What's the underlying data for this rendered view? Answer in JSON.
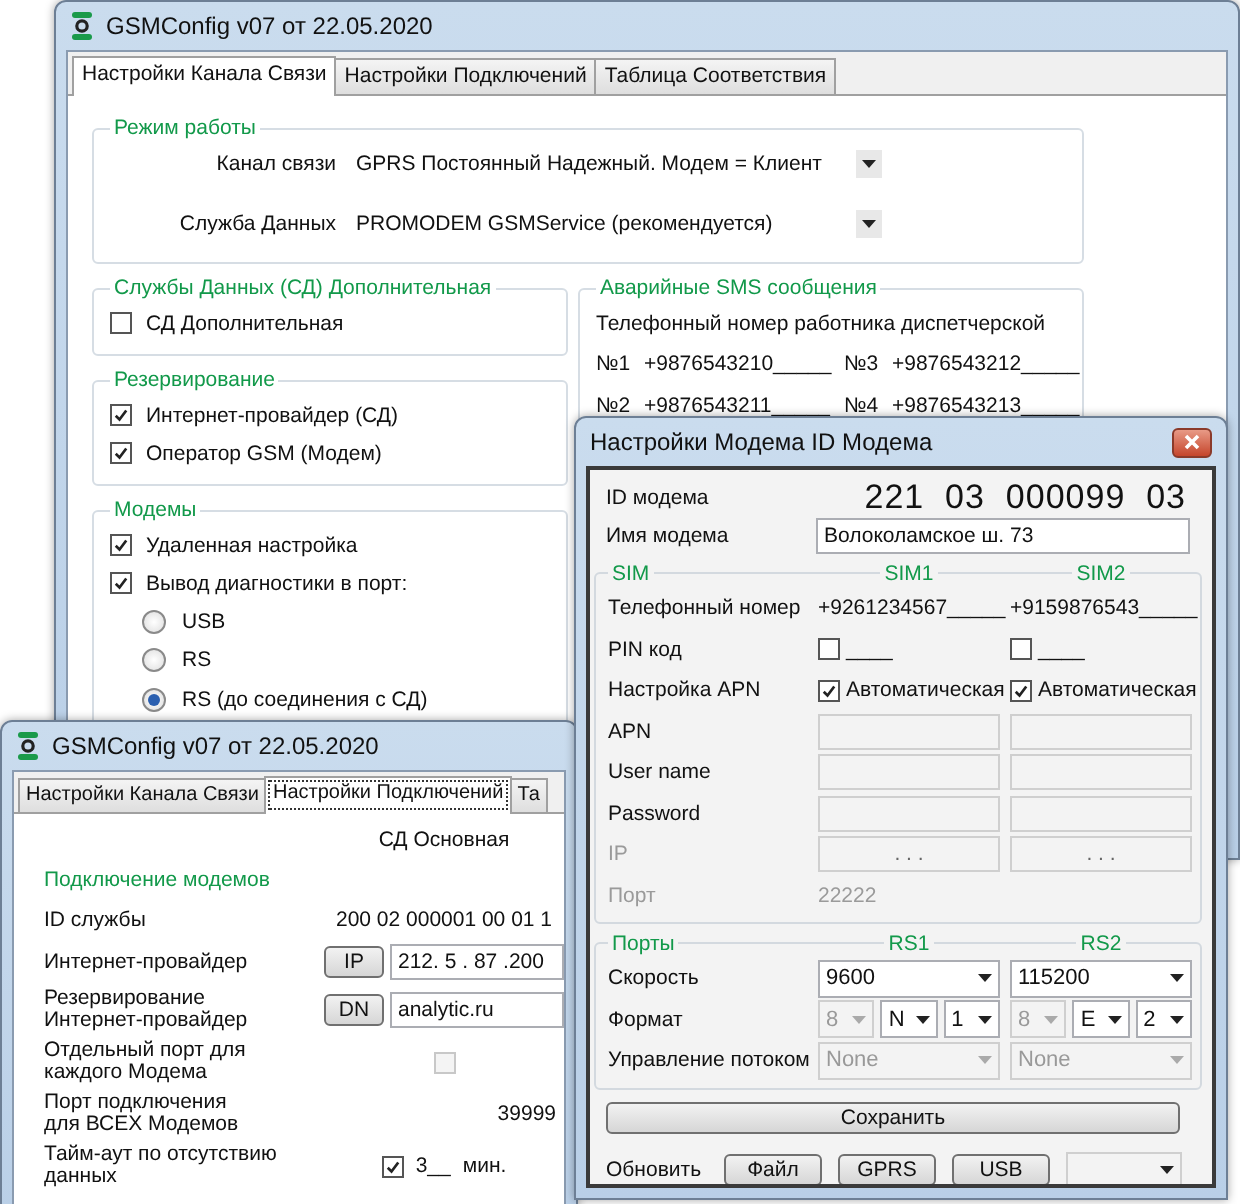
{
  "main_window": {
    "title": "GSMConfig v07 от 22.05.2020",
    "tabs": [
      {
        "label": "Настройки Канала Связи",
        "selected": true
      },
      {
        "label": "Настройки Подключений",
        "selected": false
      },
      {
        "label": "Таблица Соответствия",
        "selected": false
      }
    ],
    "mode_group": {
      "title": "Режим работы",
      "rows": [
        {
          "label": "Канал связи",
          "value": "GPRS Постоянный Надежный. Модем = Клиент"
        },
        {
          "label": "Служба Данных",
          "value": "PROMODEM GSMService (рекомендуется)"
        }
      ]
    },
    "extra_group": {
      "title": "Службы Данных (СД) Дополнительная",
      "items": [
        {
          "label": "СД Дополнительная",
          "checked": false
        }
      ]
    },
    "reserve_group": {
      "title": "Резервирование",
      "items": [
        {
          "label": "Интернет-провайдер (СД)",
          "checked": true
        },
        {
          "label": "Оператор GSM (Модем)",
          "checked": true
        }
      ]
    },
    "modems_group": {
      "title": "Модемы",
      "items": [
        {
          "label": "Удаленная настройка",
          "checked": true
        },
        {
          "label": "Вывод диагностики в порт:",
          "checked": true
        }
      ],
      "port_options": [
        {
          "label": "USB",
          "selected": false
        },
        {
          "label": "RS",
          "selected": false
        },
        {
          "label": "RS (до соединения с СД)",
          "selected": true
        }
      ]
    },
    "sms_group": {
      "title": "Аварийные SMS сообщения",
      "caption": "Телефонный номер работника диспетчерской",
      "numbers": [
        {
          "label": "№1",
          "value": "+9876543210_____"
        },
        {
          "label": "№3",
          "value": "+9876543212_____"
        },
        {
          "label": "№2",
          "value": "+9876543211_____"
        },
        {
          "label": "№4",
          "value": "+9876543213_____"
        }
      ]
    }
  },
  "connections_window": {
    "title": "GSMConfig v07 от 22.05.2020",
    "tabs": [
      {
        "label": "Настройки Канала Связи",
        "selected": false
      },
      {
        "label": "Настройки Подключений",
        "selected": true
      },
      {
        "label": "Та",
        "selected": false
      }
    ],
    "column_header": "СД Основная",
    "section_title": "Подключение модемов",
    "rows": [
      {
        "kind": "text",
        "label": "ID службы",
        "value": "200 02 000001 00 01 1"
      },
      {
        "kind": "button_field",
        "label": "Интернет-провайдер",
        "button": "IP",
        "value": "212. 5 . 87 .200"
      },
      {
        "kind": "button_field",
        "label": "Резервирование\nИнтернет-провайдер",
        "button": "DN",
        "value": "analytic.ru"
      },
      {
        "kind": "check",
        "label": "Отдельный порт для\nкаждого Модема",
        "checked": false,
        "disabled": true
      },
      {
        "kind": "value",
        "label": "Порт подключения\nдля ВСЕХ Модемов",
        "value": "39999"
      },
      {
        "kind": "timeout",
        "label": "Тайм-аут по отсутствию\nданных",
        "checked": true,
        "value": "3__",
        "unit": "мин."
      }
    ]
  },
  "modem_dialog": {
    "title": "Настройки Модема ID Модема",
    "id_label": "ID модема",
    "id_value": "221  03  000099  03",
    "name_label": "Имя модема",
    "name_value": "Волоколамское ш. 73",
    "sim_group": {
      "title": "SIM",
      "columns": [
        "SIM1",
        "SIM2"
      ],
      "rows": [
        {
          "kind": "text",
          "label": "Телефонный номер",
          "disabled": false,
          "cells": [
            "+9261234567_____",
            "+9159876543_____"
          ]
        },
        {
          "kind": "check",
          "label": "PIN код",
          "disabled": false,
          "cells": [
            {
              "checked": false,
              "text": "____"
            },
            {
              "checked": false,
              "text": "____"
            }
          ]
        },
        {
          "kind": "check",
          "label": "Настройка APN",
          "disabled": false,
          "cells": [
            {
              "checked": true,
              "text": "Автоматическая"
            },
            {
              "checked": true,
              "text": "Автоматическая"
            }
          ]
        },
        {
          "kind": "field",
          "label": "APN",
          "disabled": false,
          "cells": [
            "",
            ""
          ]
        },
        {
          "kind": "field",
          "label": "User name",
          "disabled": false,
          "cells": [
            "",
            ""
          ]
        },
        {
          "kind": "field",
          "label": "Password",
          "disabled": false,
          "cells": [
            "",
            ""
          ]
        },
        {
          "kind": "field",
          "label": "IP",
          "disabled": true,
          "cells": [
            ".     .     .",
            ".     .     ."
          ]
        },
        {
          "kind": "text",
          "label": "Порт",
          "disabled": true,
          "cells": [
            "22222"
          ]
        }
      ]
    },
    "ports_group": {
      "title": "Порты",
      "columns": [
        "RS1",
        "RS2"
      ],
      "rows": [
        {
          "kind": "combo",
          "label": "Скорость",
          "cells": [
            [
              {
                "value": "9600",
                "disabled": false
              }
            ],
            [
              {
                "value": "115200",
                "disabled": false
              }
            ]
          ]
        },
        {
          "kind": "format",
          "label": "Формат",
          "cells": [
            [
              {
                "value": "8",
                "disabled": true
              },
              {
                "value": "N",
                "disabled": false
              },
              {
                "value": "1",
                "disabled": false
              }
            ],
            [
              {
                "value": "8",
                "disabled": true
              },
              {
                "value": "E",
                "disabled": false
              },
              {
                "value": "2",
                "disabled": false
              }
            ]
          ]
        },
        {
          "kind": "combo",
          "label": "Управление потоком",
          "cells": [
            [
              {
                "value": "None",
                "disabled": true
              }
            ],
            [
              {
                "value": "None",
                "disabled": true
              }
            ]
          ]
        }
      ]
    },
    "save_button": "Сохранить",
    "refresh_label": "Обновить",
    "refresh_buttons": [
      "Файл",
      "GPRS",
      "USB"
    ]
  }
}
